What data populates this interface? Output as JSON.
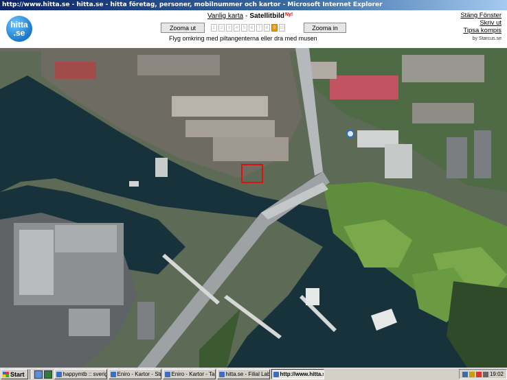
{
  "window": {
    "title": "http://www.hitta.se - hitta.se - hitta företag, personer, mobilnummer och kartor - Microsoft Internet Explorer"
  },
  "logo": {
    "line1": "hitta",
    "line2": ".se"
  },
  "mapmode": {
    "normal": "Vanlig karta",
    "separator": "-",
    "satellite": "Satellitbild",
    "new_badge": "Ny!"
  },
  "zoom": {
    "out_label": "Zooma ut",
    "in_label": "Zooma in",
    "levels": [
      "1",
      "2",
      "3",
      "4",
      "5",
      "6",
      "7",
      "8",
      "9",
      "10"
    ],
    "selected": "9"
  },
  "instructions": "Flyg omkring med piltangenterna eller dra med musen",
  "links": {
    "close": "Stäng Fönster",
    "print": "Skriv ut",
    "tip": "Tipsa kompis"
  },
  "credit": "by Starcus.se",
  "taskbar": {
    "start_label": "Start",
    "tasks": [
      {
        "label": "happymtb :: sveriges tre...",
        "active": false
      },
      {
        "label": "Eniro - Kartor - Street Ho...",
        "active": false
      },
      {
        "label": "Eniro - Kartor - Tantolun...",
        "active": false
      },
      {
        "label": "hitta.se - Filial Lab. Horn...",
        "active": false
      },
      {
        "label": "http://www.hitta.se - ...",
        "active": true
      }
    ],
    "clock": "19:02"
  },
  "colors": {
    "accent": "#f29400",
    "logo_blue": "#1c79c8",
    "marker": "#e01010",
    "water": "#17323a"
  }
}
